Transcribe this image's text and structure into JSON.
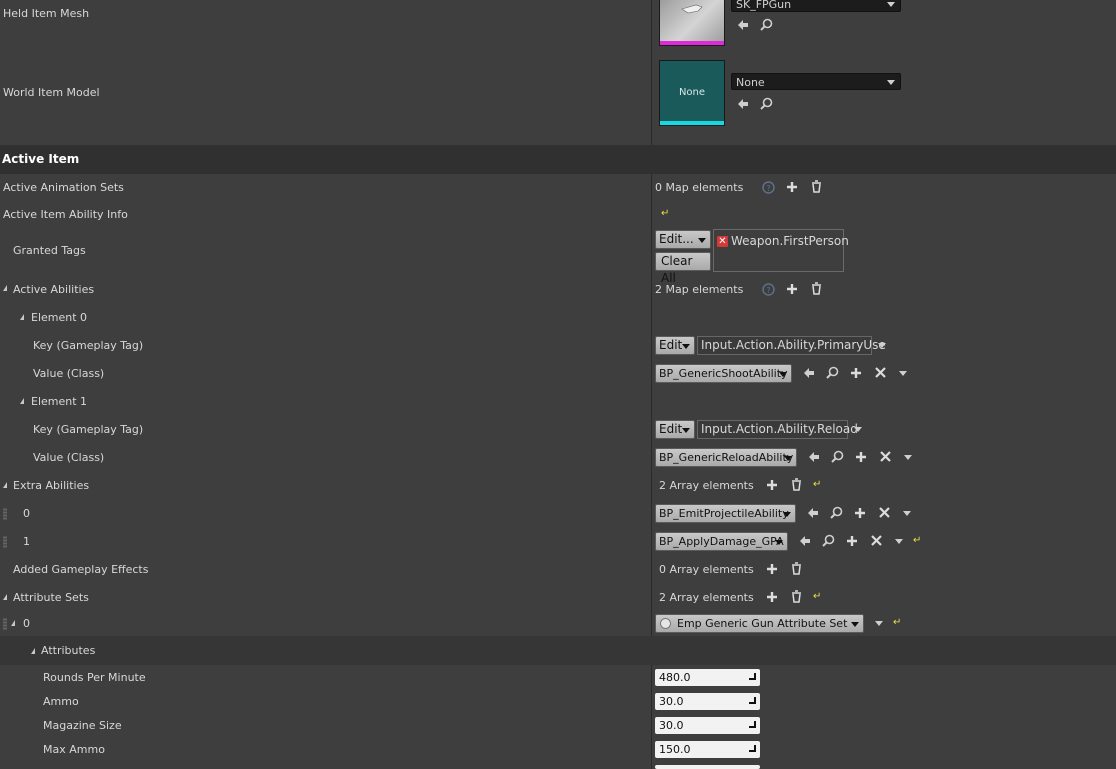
{
  "rows": {
    "held_item_mesh": {
      "label": "Held Item Mesh",
      "value": "SK_FPGun"
    },
    "world_item_model": {
      "label": "World Item Model",
      "value": "None",
      "thumb_text": "None"
    },
    "active_item_section": {
      "label": "Active Item"
    },
    "active_animation_sets": {
      "label": "Active Animation Sets",
      "count": "0 Map elements"
    },
    "active_item_ability_info": {
      "label": "Active Item Ability Info"
    },
    "granted_tags": {
      "label": "Granted Tags",
      "edit_label": "Edit...",
      "clear_label": "Clear All",
      "tag": "Weapon.FirstPerson"
    },
    "active_abilities": {
      "label": "Active Abilities",
      "count": "2 Map elements"
    },
    "element0": {
      "label": "Element 0"
    },
    "element0_key": {
      "label": "Key (Gameplay Tag)",
      "edit_label": "Edit",
      "tag": "Input.Action.Ability.PrimaryUse"
    },
    "element0_value": {
      "label": "Value (Class)",
      "value": "BP_GenericShootAbility"
    },
    "element1": {
      "label": "Element 1"
    },
    "element1_key": {
      "label": "Key (Gameplay Tag)",
      "edit_label": "Edit",
      "tag": "Input.Action.Ability.Reload"
    },
    "element1_value": {
      "label": "Value (Class)",
      "value": "BP_GenericReloadAbility"
    },
    "extra_abilities": {
      "label": "Extra Abilities",
      "count": "2 Array elements"
    },
    "extra0": {
      "label": "0",
      "value": "BP_EmitProjectileAbility"
    },
    "extra1": {
      "label": "1",
      "value": "BP_ApplyDamage_GPA"
    },
    "added_gameplay_effects": {
      "label": "Added Gameplay Effects",
      "count": "0 Array elements"
    },
    "attribute_sets": {
      "label": "Attribute Sets",
      "count": "2 Array elements"
    },
    "attr0": {
      "label": "0",
      "value": "Emp Generic Gun Attribute Set"
    },
    "attributes": {
      "label": "Attributes"
    },
    "rounds_per_minute": {
      "label": "Rounds Per Minute",
      "value": "480.0"
    },
    "ammo": {
      "label": "Ammo",
      "value": "30.0"
    },
    "magazine_size": {
      "label": "Magazine Size",
      "value": "30.0"
    },
    "max_ammo": {
      "label": "Max Ammo",
      "value": "150.0"
    }
  },
  "colors": {
    "panel_bg": "#3e3e3e",
    "section_bg": "#303030",
    "mesh_thumb_accent": "#e02ad8",
    "world_thumb_accent": "#19d8e0",
    "world_thumb_bg": "#1b5a5a",
    "reset_arrow": "#e8e04a",
    "tag_remove": "#d23a3a"
  },
  "icons": [
    "arrow-left-icon",
    "search-icon",
    "plus-icon",
    "trash-icon",
    "help-icon",
    "close-icon",
    "reset-arrow-icon",
    "resize-icon",
    "tag-remove-icon"
  ]
}
